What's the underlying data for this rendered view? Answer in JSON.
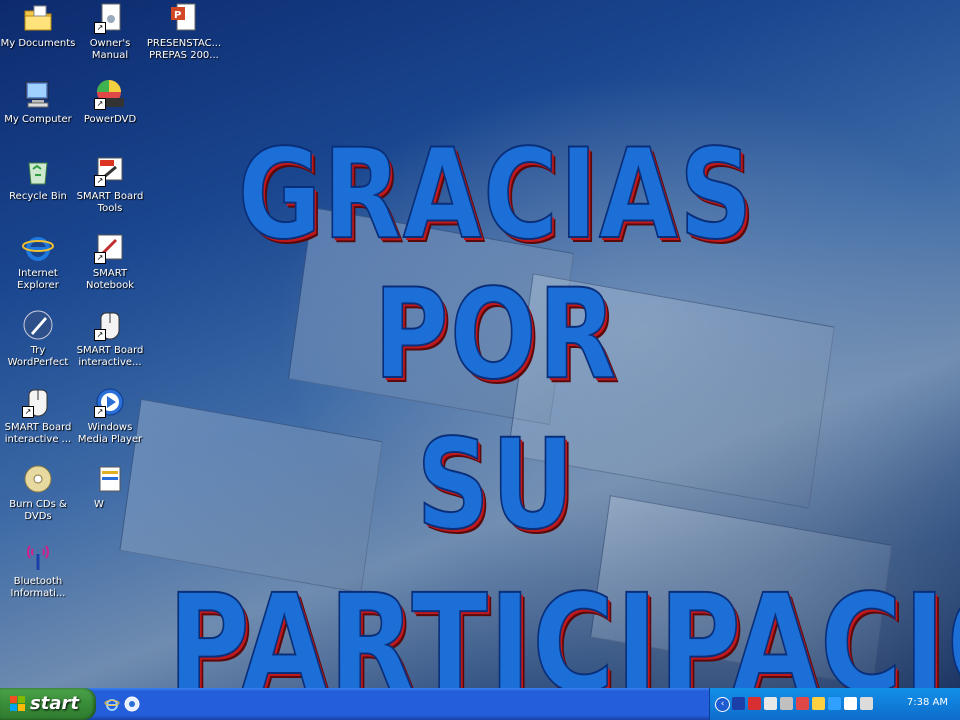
{
  "desktop": {
    "icons": [
      {
        "name": "folder-icon",
        "label": "My Documents"
      },
      {
        "name": "manual-icon",
        "label": "Owner's Manual"
      },
      {
        "name": "powerpoint-icon",
        "label": "PRESENSTAC... PREPAS 200..."
      },
      {
        "name": "computer-icon",
        "label": "My Computer"
      },
      {
        "name": "powerdvd-icon",
        "label": "PowerDVD"
      },
      {
        "name": "recycle-bin-icon",
        "label": "Recycle Bin"
      },
      {
        "name": "smart-board-tools-icon",
        "label": "SMART Board Tools"
      },
      {
        "name": "internet-explorer-icon",
        "label": "Internet Explorer"
      },
      {
        "name": "smart-notebook-icon",
        "label": "SMART Notebook"
      },
      {
        "name": "wordperfect-icon",
        "label": "Try WordPerfect"
      },
      {
        "name": "smart-board-interactive-icon",
        "label": "SMART Board interactive..."
      },
      {
        "name": "smart-board-interactive-icon",
        "label": "SMART Board interactive ..."
      },
      {
        "name": "windows-media-player-icon",
        "label": "Windows Media Player"
      },
      {
        "name": "burn-cds-icon",
        "label": "Burn CDs & DVDs"
      },
      {
        "name": "partial-icon",
        "label": "W"
      },
      {
        "name": "bluetooth-icon",
        "label": "Bluetooth Informati..."
      }
    ]
  },
  "headline": {
    "line1": "GRACIAS POR",
    "line2": "SU",
    "line3": "PARTICIPACION"
  },
  "taskbar": {
    "start_label": "start",
    "quick_launch": [
      "internet-explorer-icon",
      "browser-icon"
    ],
    "tray_icons": [
      "bluetooth-icon",
      "security-icon",
      "network-icon",
      "monitor-icon",
      "speaker-icon",
      "update-icon",
      "battery-icon",
      "signal-icon",
      "power-icon"
    ],
    "clock": "7:38 AM"
  },
  "colors": {
    "headline_fill": "#1d6fd8",
    "headline_shadow": "#c0181c",
    "taskbar": "#245edb",
    "start_button": "#3a8f3a"
  }
}
